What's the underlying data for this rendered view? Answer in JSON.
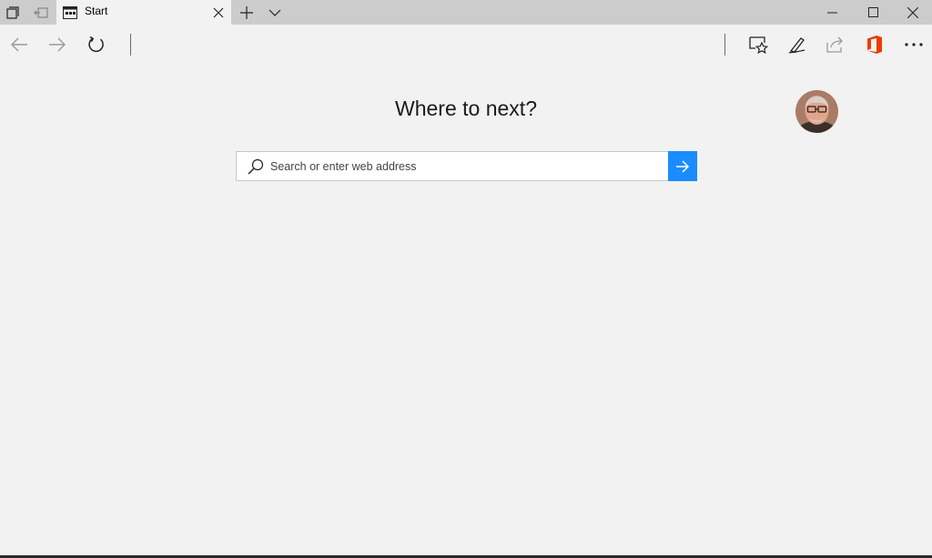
{
  "tab": {
    "title": "Start"
  },
  "main": {
    "heading": "Where to next?",
    "search_placeholder": "Search or enter web address"
  },
  "colors": {
    "tabbar_bg": "#cccccc",
    "page_bg": "#f2f2f2",
    "go_button": "#1a8cff",
    "office_icon": "#eb3c00"
  },
  "icons": {
    "tab_bar": [
      "tab-preview-icon",
      "set-aside-tabs-icon",
      "new-tab-icon",
      "tab-list-chevron-icon"
    ],
    "window": [
      "minimize-icon",
      "maximize-icon",
      "close-icon"
    ],
    "nav": [
      "back-arrow-icon",
      "forward-arrow-icon",
      "refresh-icon"
    ],
    "toolbar_right": [
      "favorites-star-icon",
      "pen-icon",
      "share-icon",
      "office-icon",
      "more-icon"
    ]
  }
}
